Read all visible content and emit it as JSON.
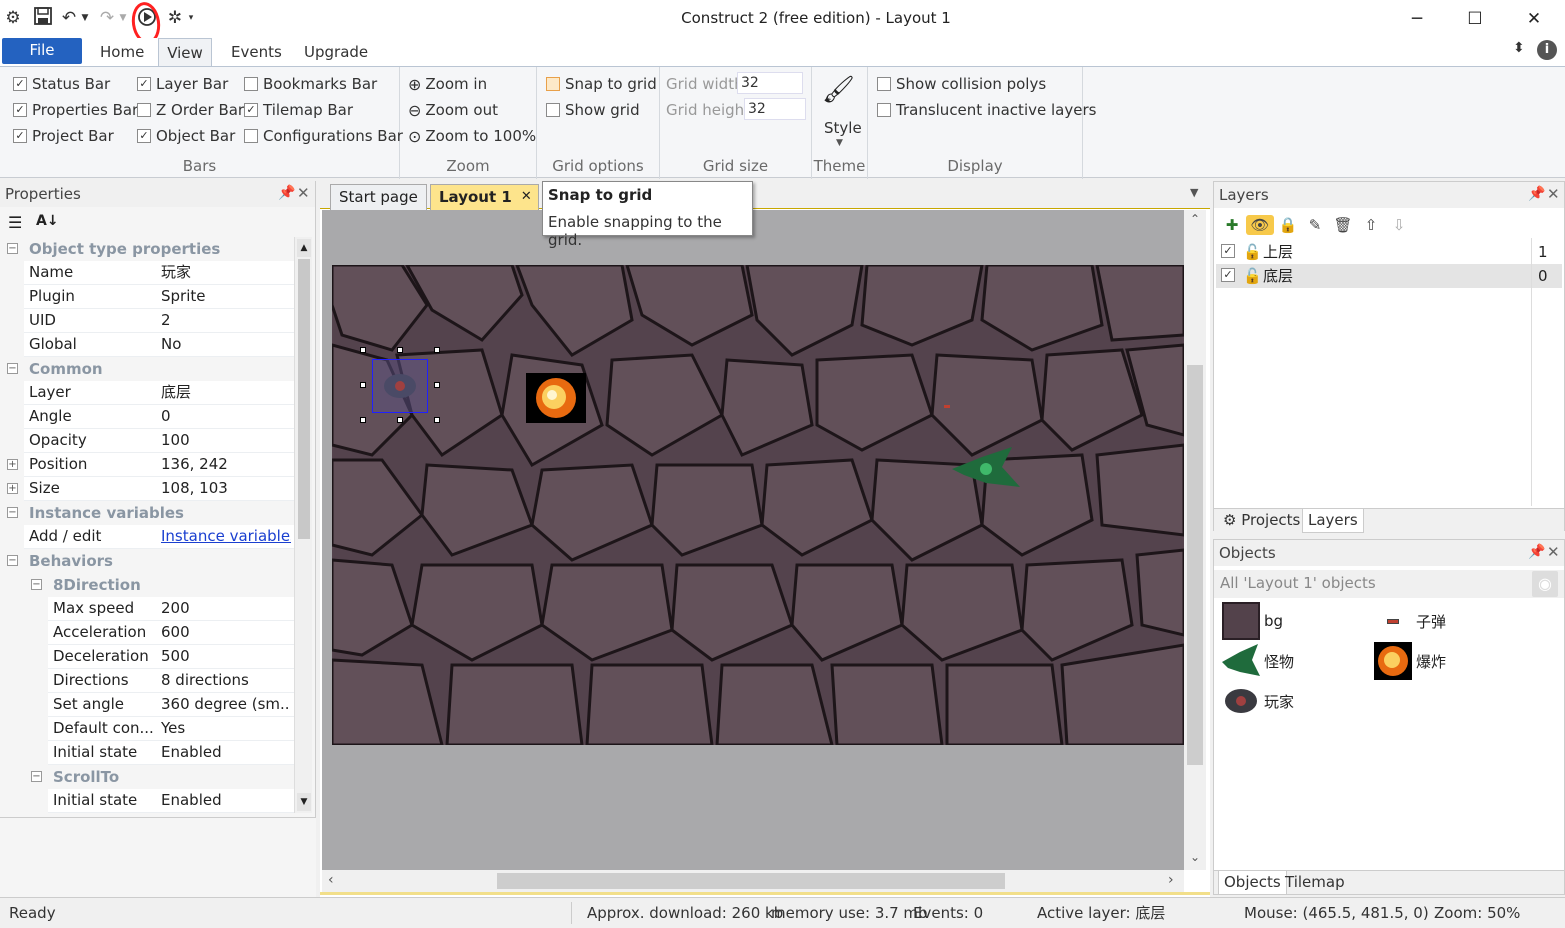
{
  "window": {
    "title": "Construct 2  (free edition) - Layout 1",
    "min_icon": "minimize-icon",
    "max_icon": "maximize-icon",
    "close_icon": "close-icon"
  },
  "quick_access": [
    "app-logo-icon",
    "save-icon",
    "undo-icon",
    "redo-icon",
    "run-layout-icon",
    "debug-layout-icon"
  ],
  "ribbon": {
    "tabs": [
      "File",
      "Home",
      "View",
      "Events",
      "Upgrade"
    ],
    "active_tab": "View",
    "bars": {
      "label": "Bars",
      "items": [
        {
          "label": "Status Bar",
          "checked": true
        },
        {
          "label": "Properties Bar",
          "checked": true
        },
        {
          "label": "Project Bar",
          "checked": true
        },
        {
          "label": "Layer Bar",
          "checked": true
        },
        {
          "label": "Z Order Bar",
          "checked": false
        },
        {
          "label": "Object Bar",
          "checked": true
        },
        {
          "label": "Bookmarks Bar",
          "checked": false
        },
        {
          "label": "Tilemap Bar",
          "checked": true
        },
        {
          "label": "Configurations Bar",
          "checked": false
        }
      ]
    },
    "zoom": {
      "label": "Zoom",
      "items": [
        "Zoom in",
        "Zoom out",
        "Zoom to 100%"
      ]
    },
    "grid_options": {
      "label": "Grid options",
      "snap": "Snap to grid",
      "show": "Show grid"
    },
    "grid_size": {
      "label": "Grid size",
      "width_label": "Grid width",
      "width_value": "32",
      "height_label": "Grid height",
      "height_value": "32"
    },
    "theme": {
      "label": "Theme",
      "style": "Style"
    },
    "display": {
      "label": "Display",
      "items": [
        {
          "label": "Show collision polys",
          "checked": false
        },
        {
          "label": "Translucent inactive layers",
          "checked": false
        }
      ]
    }
  },
  "tooltip": {
    "title": "Snap to grid",
    "body": "Enable snapping to the grid."
  },
  "properties": {
    "title": "Properties",
    "sections": {
      "object_type": "Object type properties",
      "common": "Common",
      "instance_vars": "Instance variables",
      "behaviors": "Behaviors",
      "eightdir": "8Direction",
      "scrollto": "ScrollTo"
    },
    "rows": {
      "name": {
        "k": "Name",
        "v": "玩家"
      },
      "plugin": {
        "k": "Plugin",
        "v": "Sprite"
      },
      "uid": {
        "k": "UID",
        "v": "2"
      },
      "global": {
        "k": "Global",
        "v": "No"
      },
      "layer": {
        "k": "Layer",
        "v": "底层"
      },
      "angle": {
        "k": "Angle",
        "v": "0"
      },
      "opacity": {
        "k": "Opacity",
        "v": "100"
      },
      "position": {
        "k": "Position",
        "v": "136, 242"
      },
      "size": {
        "k": "Size",
        "v": "108, 103"
      },
      "addedit": {
        "k": "Add / edit",
        "v": "Instance variables"
      },
      "maxspeed": {
        "k": "Max speed",
        "v": "200"
      },
      "accel": {
        "k": "Acceleration",
        "v": "600"
      },
      "decel": {
        "k": "Deceleration",
        "v": "500"
      },
      "directions": {
        "k": "Directions",
        "v": "8 directions"
      },
      "setangle": {
        "k": "Set angle",
        "v": "360 degree (sm..."
      },
      "defcon": {
        "k": "Default con...",
        "v": "Yes"
      },
      "initstate": {
        "k": "Initial state",
        "v": "Enabled"
      },
      "initstate2": {
        "k": "Initial state",
        "v": "Enabled"
      }
    }
  },
  "doc_tabs": [
    "Start page",
    "Layout 1"
  ],
  "layers": {
    "title": "Layers",
    "rows": [
      {
        "name": "上层",
        "index": "1",
        "checked": true
      },
      {
        "name": "底层",
        "index": "0",
        "checked": true
      }
    ],
    "bottom_tabs": [
      "Projects",
      "Layers"
    ]
  },
  "objects": {
    "title": "Objects",
    "filter": "All 'Layout 1' objects",
    "items": [
      {
        "name": "bg"
      },
      {
        "name": "子弹"
      },
      {
        "name": "怪物"
      },
      {
        "name": "爆炸"
      },
      {
        "name": "玩家"
      }
    ],
    "bottom_tabs": [
      "Objects",
      "Tilemap"
    ]
  },
  "status": {
    "ready": "Ready",
    "download": "Approx. download: 260 kb",
    "memory": "memory use: 3.7 mb",
    "events": "Events: 0",
    "active_layer": "Active layer: 底层",
    "mouse": "Mouse: (465.5, 481.5, 0)",
    "zoom": "Zoom: 50%"
  },
  "colors": {
    "file_tab": "#2462c0",
    "annotation": "#ff2020",
    "active_doc_tab": "#fde48c"
  }
}
